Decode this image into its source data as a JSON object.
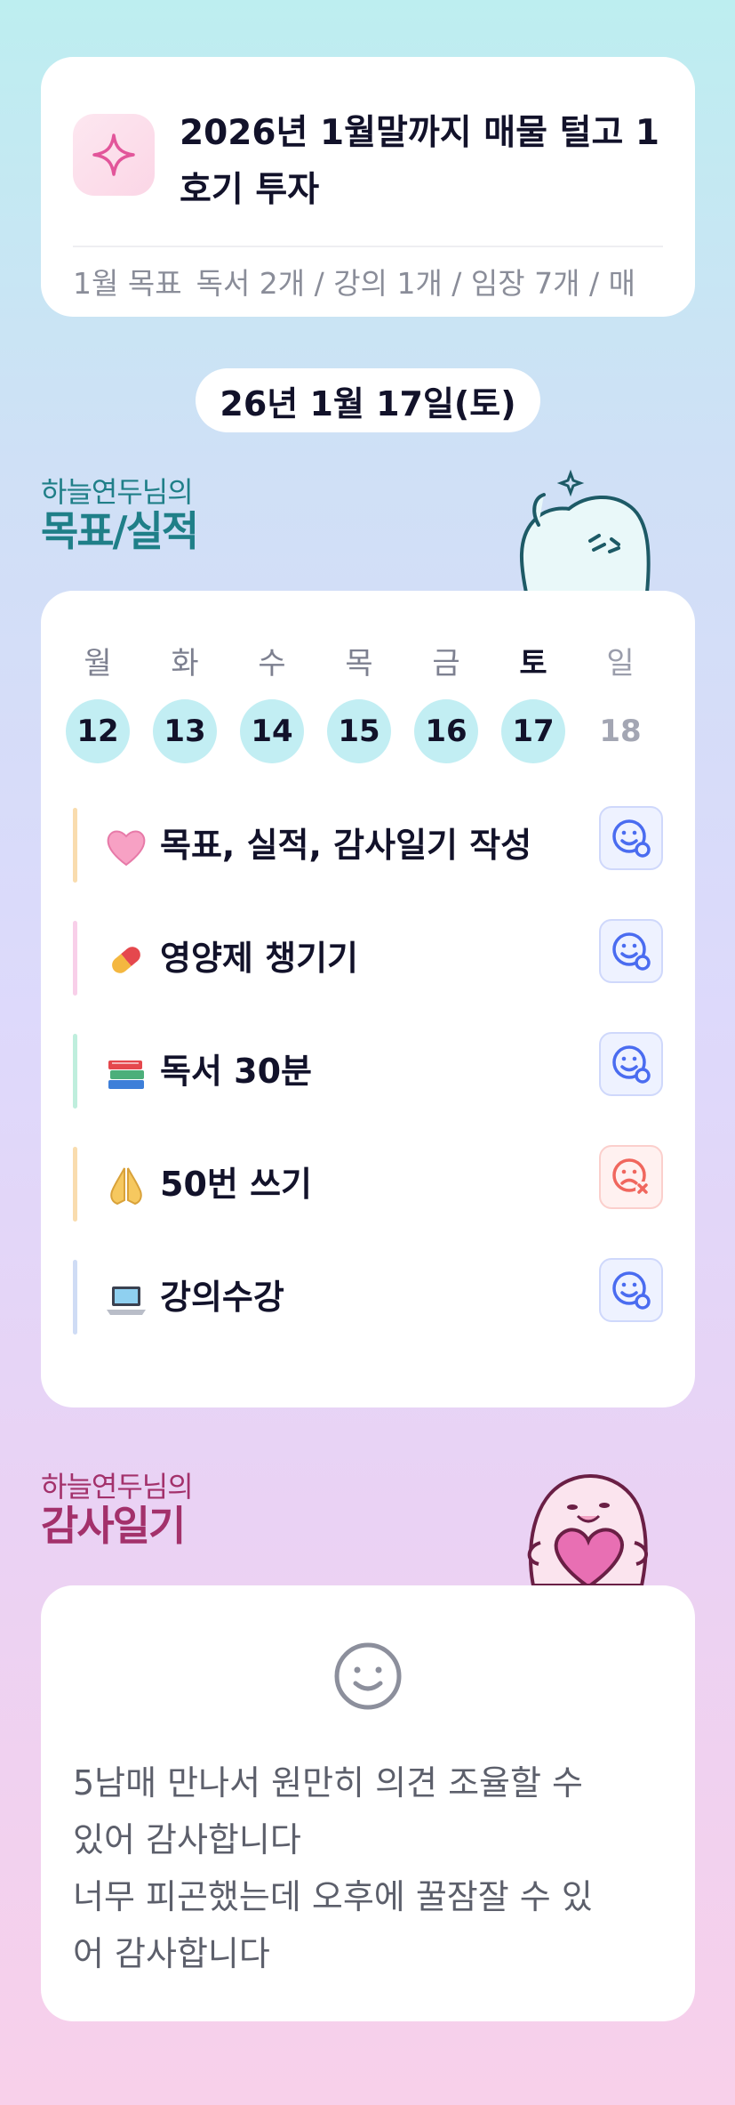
{
  "goal": {
    "icon": "sparkle-icon",
    "title": "2026년 1월말까지 매물 털고 1호기 투자",
    "month_label": "1월 목표",
    "month_text": "독서 2개 / 강의 1개 / 임장 7개 / 매"
  },
  "date": "26년 1월 17일(토)",
  "tracker_section": {
    "subtitle": "하늘연두님의",
    "title": "목표/실적"
  },
  "week": [
    {
      "day": "월",
      "num": "12",
      "state": "past"
    },
    {
      "day": "화",
      "num": "13",
      "state": "past"
    },
    {
      "day": "수",
      "num": "14",
      "state": "past"
    },
    {
      "day": "목",
      "num": "15",
      "state": "past"
    },
    {
      "day": "금",
      "num": "16",
      "state": "past"
    },
    {
      "day": "토",
      "num": "17",
      "state": "today"
    },
    {
      "day": "일",
      "num": "18",
      "state": "future"
    }
  ],
  "habits": [
    {
      "icon": "pink-heart-icon",
      "label": "목표, 실적, 감사일기 작성",
      "bar_color": "#f9dcae",
      "status": "done"
    },
    {
      "icon": "pill-icon",
      "label": "영양제 챙기기",
      "bar_color": "#f8cfe9",
      "status": "done"
    },
    {
      "icon": "books-icon",
      "label": "독서 30분",
      "bar_color": "#bfeedd",
      "status": "done"
    },
    {
      "icon": "praying-hands-icon",
      "label": "50번 쓰기",
      "bar_color": "#f9dcae",
      "status": "fail"
    },
    {
      "icon": "laptop-icon",
      "label": "강의수강",
      "bar_color": "#cfdcf5",
      "status": "done"
    }
  ],
  "gratitude_section": {
    "subtitle": "하늘연두님의",
    "title": "감사일기"
  },
  "gratitude": {
    "icon": "smile-face-icon",
    "text": "5남매 만나서 원만히 의견 조율할 수\n있어 감사합니다\n너무 피곤했는데 오후에 꿀잠잘 수 있\n어 감사합니다"
  },
  "colors": {
    "accent_blue": "#4a6cf0",
    "fail_red": "#f0675e",
    "day_circle": "#c2eef3",
    "teal_heading": "#1f7f88",
    "magenta_heading": "#a3316b"
  }
}
